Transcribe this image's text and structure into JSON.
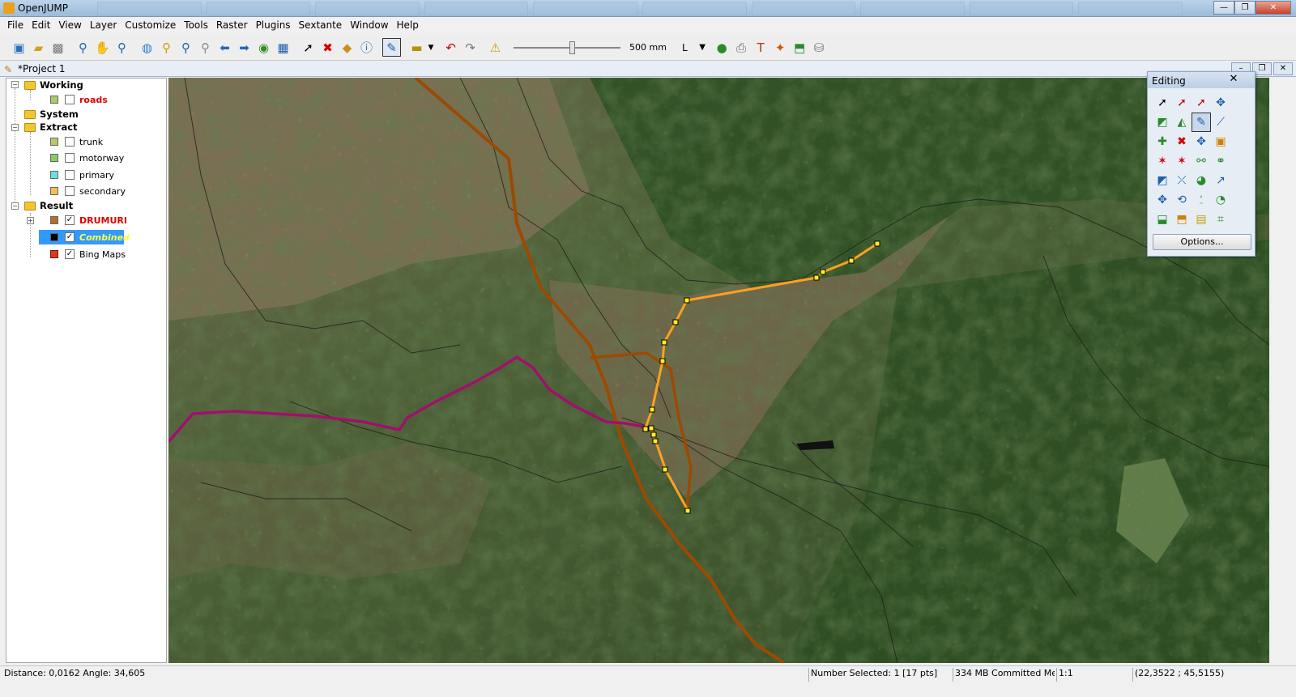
{
  "window": {
    "title": "OpenJUMP",
    "controls": [
      "—",
      "❐",
      "✕"
    ]
  },
  "menu": [
    "File",
    "Edit",
    "View",
    "Layer",
    "Customize",
    "Tools",
    "Raster",
    "Plugins",
    "Sextante",
    "Window",
    "Help"
  ],
  "toolbar": {
    "icons": [
      "new-project-icon",
      "open-project-icon",
      "save-project-icon",
      "zoom-in-icon",
      "pan-icon",
      "zoom-window-icon",
      "full-extent-icon",
      "zoom-to-selection-icon",
      "zoom-previous-icon",
      "zoom-next-icon",
      "previous-view-icon",
      "next-view-icon",
      "zoom-fence-icon",
      "grid-icon",
      "select-icon",
      "delete-icon",
      "cube-icon",
      "info-icon",
      "editing-toolbox-icon",
      "measure-icon",
      "undo-icon",
      "redo-icon",
      "warning-icon"
    ],
    "scale_label": "500 mm",
    "scale_level": 0.55,
    "style_label": "L"
  },
  "project": {
    "title": "*Project 1"
  },
  "layers": {
    "categories": [
      {
        "name": "Working",
        "layers": [
          {
            "name": "roads",
            "color": "#aacc66",
            "checked": false,
            "style": "red"
          }
        ]
      },
      {
        "name": "System",
        "layers": []
      },
      {
        "name": "Extract",
        "layers": [
          {
            "name": "trunk",
            "color": "#bcc56a",
            "checked": false
          },
          {
            "name": "motorway",
            "color": "#88cc66",
            "checked": false
          },
          {
            "name": "primary",
            "color": "#66e0e0",
            "checked": false
          },
          {
            "name": "secondary",
            "color": "#f0c050",
            "checked": false
          }
        ]
      },
      {
        "name": "Result",
        "layers": [
          {
            "name": "DRUMURI",
            "color": "#b0702a",
            "checked": true,
            "style": "red"
          },
          {
            "name": "Combined",
            "color": "#000000",
            "checked": true,
            "style": "highlight"
          },
          {
            "name": "Bing Maps",
            "color": "#d04020",
            "checked": true
          }
        ]
      }
    ]
  },
  "editing_panel": {
    "title": "Editing",
    "close": "✕",
    "options_label": "Options...",
    "tools": [
      "select-features-icon",
      "select-parts-icon",
      "select-linestrings-icon",
      "move-selected-icon",
      "draw-polygon-icon",
      "draw-rectangle-icon",
      "draw-linestring-icon",
      "draw-line-icon",
      "add-point-icon",
      "delete-vertex-icon",
      "move-vertex-icon",
      "fill-polygon-icon",
      "snap-icon",
      "auto-complete-icon",
      "split-line-icon",
      "join-icon",
      "reshape-icon",
      "rotate-icon",
      "scale-icon",
      "extend-icon",
      "move-icon",
      "cut-icon",
      "measure-length-icon",
      "node-icon",
      "paste-icon",
      "copy-icon",
      "paint-icon",
      "trim-icon"
    ],
    "active_index": 6
  },
  "map": {
    "colors": {
      "forest": "#35552a",
      "field": "#7b6a4e",
      "road_orange": "#9c4a00",
      "road_purple": "#a0106c",
      "road_selected": "#ffa020"
    }
  },
  "status": {
    "distance": "Distance: 0,0162   Angle: 34,605",
    "selected": "Number Selected: 1 [17 pts]",
    "memory": "334 MB Committed Me...",
    "scale": "1:1",
    "coords": "(22,3522 ; 45,5155)"
  }
}
